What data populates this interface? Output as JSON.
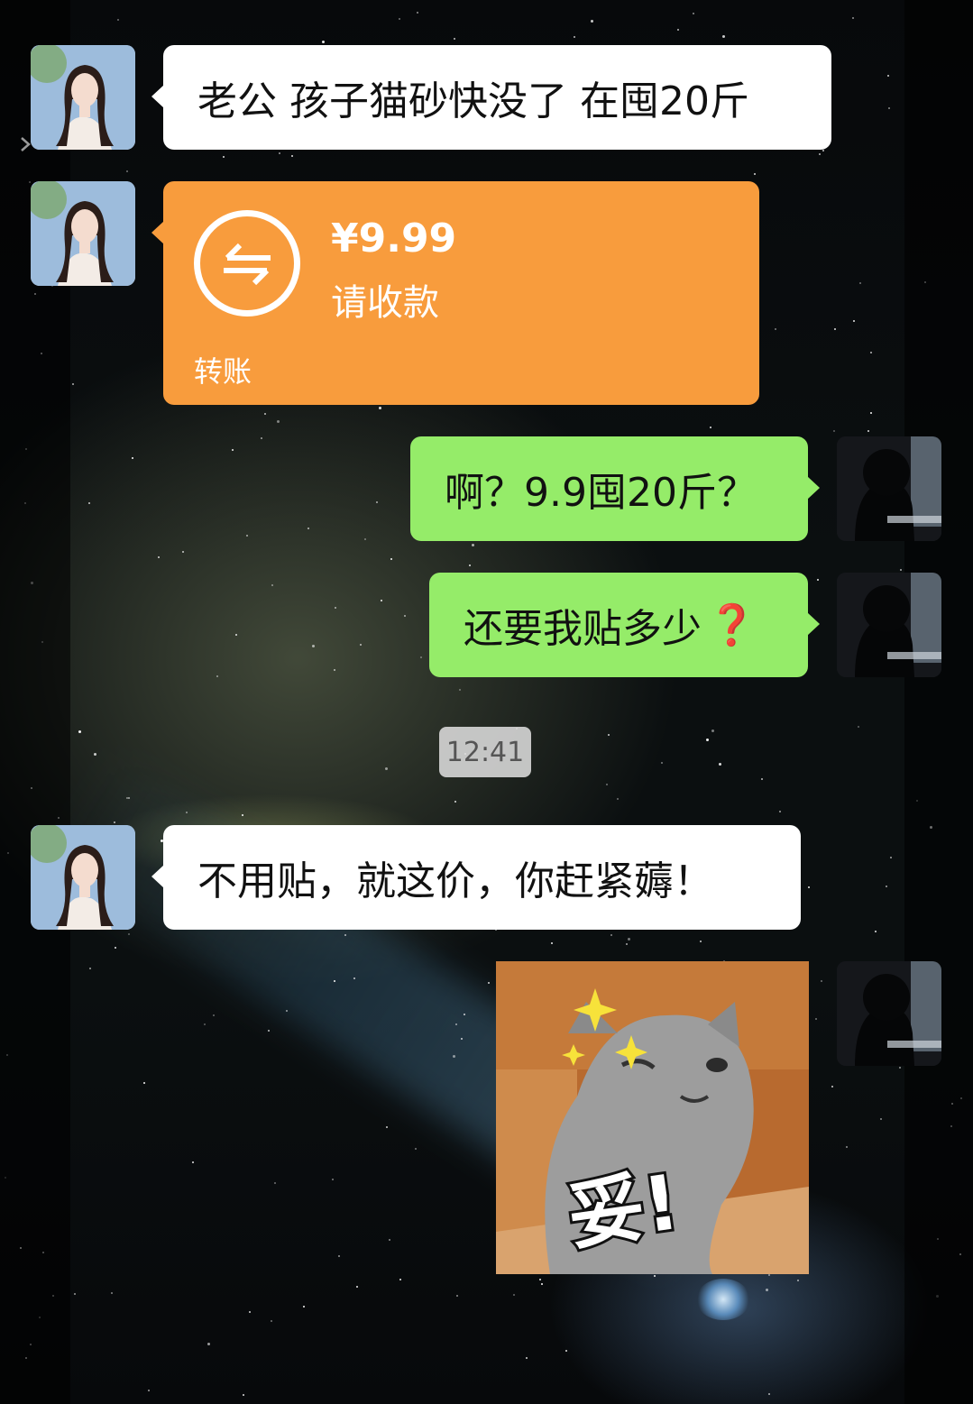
{
  "messages": [
    {
      "side": "left",
      "type": "text",
      "text": "老公 孩子猫砂快没了 在囤20斤"
    },
    {
      "side": "left",
      "type": "transfer",
      "amount": "¥9.99",
      "status": "请收款",
      "label": "转账",
      "icon": "transfer-arrows-icon"
    },
    {
      "side": "right",
      "type": "text",
      "text": "啊？9.9囤20斤？"
    },
    {
      "side": "right",
      "type": "text",
      "text": "还要我贴多少",
      "emoji": "❓"
    },
    {
      "side": "left",
      "type": "text",
      "text": "不用贴，就这价，你赶紧薅！"
    },
    {
      "side": "right",
      "type": "sticker",
      "text": "妥!"
    }
  ],
  "timestamp": "12:41",
  "colors": {
    "sent_bubble": "#95ec69",
    "received_bubble": "#ffffff",
    "transfer": "#f89c3d",
    "question_mark": "#e02020"
  }
}
